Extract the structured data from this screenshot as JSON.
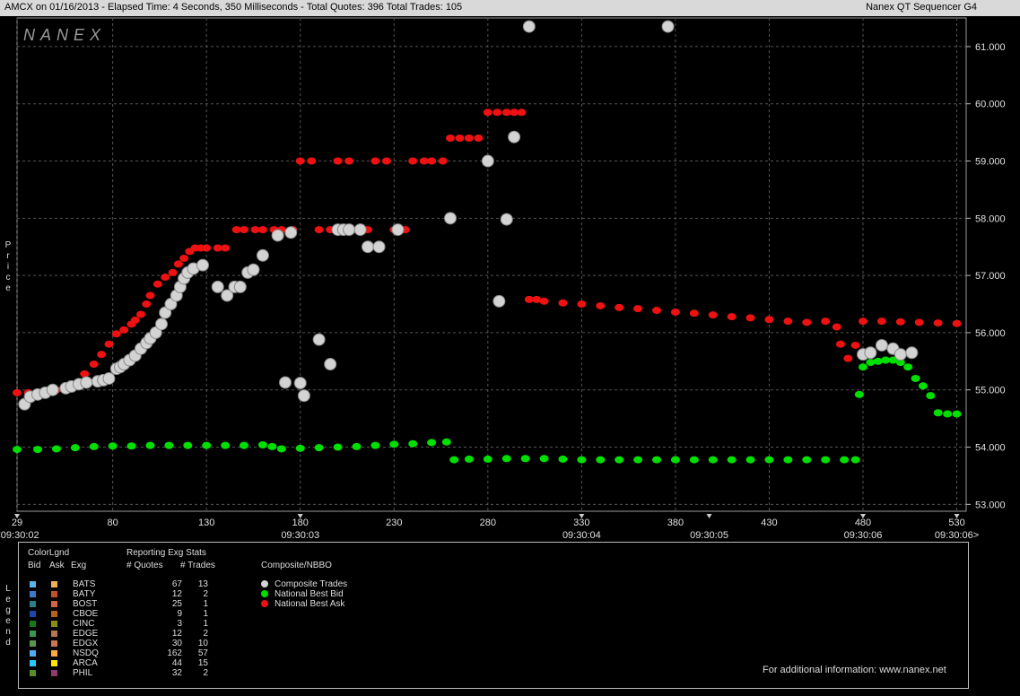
{
  "header": {
    "title": "AMCX on 01/16/2013  -  Elapsed Time: 4 Seconds, 350 Milliseconds  -  Total Quotes: 396  Total Trades: 105",
    "app_name": "Nanex QT Sequencer G4"
  },
  "watermark": "NANEX",
  "y_axis_label": [
    "P",
    "r",
    "i",
    "c",
    "e"
  ],
  "legend_axis_label": [
    "L",
    "e",
    "g",
    "e",
    "n",
    "d"
  ],
  "legend": {
    "colorlegend_title": "ColorLgnd",
    "bid_header": "Bid",
    "ask_header": "Ask",
    "exg_header": "Exg",
    "stats_title": "Reporting Exg Stats",
    "quotes_header": "# Quotes",
    "trades_header": "# Trades",
    "composite_title": "Composite/NBBO",
    "composite_items": [
      {
        "label": "Composite Trades",
        "color": "#d3d3d3"
      },
      {
        "label": "National Best Bid",
        "color": "#00e000"
      },
      {
        "label": "National Best Ask",
        "color": "#ee1111"
      }
    ],
    "exchanges": [
      {
        "name": "BATS",
        "quotes": "67",
        "trades": "13",
        "bid_color": "#5ab4e6",
        "ask_color": "#f0b050"
      },
      {
        "name": "BATY",
        "quotes": "12",
        "trades": "2",
        "bid_color": "#3c78c8",
        "ask_color": "#c05028"
      },
      {
        "name": "BOST",
        "quotes": "25",
        "trades": "1",
        "bid_color": "#2d7d8c",
        "ask_color": "#d26446"
      },
      {
        "name": "CBOE",
        "quotes": "9",
        "trades": "1",
        "bid_color": "#1e46aa",
        "ask_color": "#b46414"
      },
      {
        "name": "CINC",
        "quotes": "3",
        "trades": "1",
        "bid_color": "#167a16",
        "ask_color": "#8c8c14"
      },
      {
        "name": "EDGE",
        "quotes": "12",
        "trades": "2",
        "bid_color": "#3c9650",
        "ask_color": "#b47850"
      },
      {
        "name": "EDGX",
        "quotes": "30",
        "trades": "10",
        "bid_color": "#5a9650",
        "ask_color": "#c87850"
      },
      {
        "name": "NSDQ",
        "quotes": "162",
        "trades": "57",
        "bid_color": "#50aaf0",
        "ask_color": "#ffa83c"
      },
      {
        "name": "ARCA",
        "quotes": "44",
        "trades": "15",
        "bid_color": "#28c8ff",
        "ask_color": "#ffe600"
      },
      {
        "name": "PHIL",
        "quotes": "32",
        "trades": "2",
        "bid_color": "#5a8c28",
        "ask_color": "#8c3c6e"
      }
    ],
    "footer": "For additional information: www.nanex.net"
  },
  "chart_data": {
    "type": "scatter",
    "title": "AMCX on 01/16/2013",
    "ylabel": "Price",
    "ylim": [
      52.88,
      61.5
    ],
    "xlim": [
      29,
      535
    ],
    "y_ticks": [
      "53.000",
      "54.000",
      "55.000",
      "56.000",
      "57.000",
      "58.000",
      "59.000",
      "60.000",
      "61.000"
    ],
    "x_ticks": [
      {
        "value": 29,
        "label": "29"
      },
      {
        "value": 80,
        "label": "80"
      },
      {
        "value": 130,
        "label": "130"
      },
      {
        "value": 180,
        "label": "180"
      },
      {
        "value": 230,
        "label": "230"
      },
      {
        "value": 280,
        "label": "280"
      },
      {
        "value": 330,
        "label": "330"
      },
      {
        "value": 380,
        "label": "380"
      },
      {
        "value": 430,
        "label": "430"
      },
      {
        "value": 480,
        "label": "480"
      },
      {
        "value": 530,
        "label": "530"
      }
    ],
    "time_labels": [
      {
        "value": 29,
        "label": "<09:30:02"
      },
      {
        "value": 180,
        "label": "09:30:03"
      },
      {
        "value": 330,
        "label": "09:30:04"
      },
      {
        "value": 398,
        "label": "09:30:05"
      },
      {
        "value": 480,
        "label": "09:30:06"
      },
      {
        "value": 530,
        "label": "09:30:06>"
      }
    ],
    "grid": true,
    "series": [
      {
        "name": "National Best Bid",
        "color": "#00e000",
        "x": [
          29,
          40,
          50,
          60,
          70,
          80,
          90,
          100,
          110,
          120,
          130,
          140,
          150,
          160,
          165,
          170,
          180,
          190,
          200,
          210,
          220,
          230,
          240,
          250,
          258,
          262,
          270,
          280,
          290,
          300,
          310,
          320,
          330,
          340,
          350,
          360,
          370,
          380,
          390,
          400,
          410,
          420,
          430,
          440,
          450,
          460,
          470,
          476,
          478,
          480,
          484,
          488,
          492,
          496,
          500,
          504,
          508,
          512,
          516,
          520,
          525,
          530
        ],
        "y": [
          53.96,
          53.96,
          53.97,
          53.99,
          54.01,
          54.02,
          54.02,
          54.03,
          54.03,
          54.03,
          54.03,
          54.03,
          54.03,
          54.04,
          54.01,
          53.97,
          53.98,
          53.99,
          54.0,
          54.01,
          54.03,
          54.05,
          54.06,
          54.08,
          54.09,
          53.78,
          53.79,
          53.79,
          53.8,
          53.8,
          53.8,
          53.79,
          53.78,
          53.78,
          53.78,
          53.78,
          53.78,
          53.78,
          53.78,
          53.78,
          53.78,
          53.78,
          53.78,
          53.78,
          53.78,
          53.78,
          53.78,
          53.78,
          54.92,
          55.4,
          55.48,
          55.5,
          55.52,
          55.52,
          55.48,
          55.4,
          55.2,
          55.07,
          54.9,
          54.6,
          54.58,
          54.58
        ]
      },
      {
        "name": "National Best Ask",
        "color": "#ee1111",
        "x": [
          29,
          35,
          40,
          45,
          50,
          55,
          60,
          65,
          70,
          74,
          78,
          82,
          86,
          90,
          92,
          95,
          98,
          100,
          104,
          108,
          112,
          115,
          118,
          121,
          124,
          127,
          130,
          136,
          140,
          146,
          150,
          156,
          160,
          166,
          170,
          176,
          180,
          186,
          190,
          196,
          200,
          206,
          210,
          216,
          220,
          226,
          230,
          236,
          240,
          246,
          250,
          256,
          260,
          265,
          270,
          275,
          280,
          285,
          290,
          294,
          298,
          302,
          306,
          310,
          320,
          330,
          340,
          350,
          360,
          370,
          380,
          390,
          400,
          410,
          420,
          430,
          440,
          450,
          460,
          466,
          468,
          472,
          476,
          480,
          490,
          500,
          510,
          520,
          530
        ],
        "y": [
          54.95,
          54.95,
          54.96,
          54.98,
          55.0,
          55.05,
          55.1,
          55.28,
          55.45,
          55.62,
          55.8,
          55.98,
          56.05,
          56.15,
          56.22,
          56.32,
          56.5,
          56.65,
          56.85,
          56.97,
          57.05,
          57.2,
          57.3,
          57.42,
          57.48,
          57.48,
          57.48,
          57.48,
          57.48,
          57.8,
          57.8,
          57.8,
          57.8,
          57.8,
          57.8,
          57.8,
          59.0,
          59.0,
          57.8,
          57.8,
          59.0,
          59.0,
          57.8,
          57.8,
          59.0,
          59.0,
          57.8,
          57.8,
          59.0,
          59.0,
          59.0,
          59.0,
          59.4,
          59.4,
          59.4,
          59.4,
          59.85,
          59.85,
          59.85,
          59.85,
          59.85,
          56.58,
          56.58,
          56.55,
          56.52,
          56.5,
          56.47,
          56.44,
          56.42,
          56.39,
          56.36,
          56.34,
          56.31,
          56.28,
          56.26,
          56.23,
          56.2,
          56.18,
          56.2,
          56.1,
          55.8,
          55.55,
          55.78,
          56.2,
          56.2,
          56.19,
          56.18,
          56.17,
          56.16
        ]
      },
      {
        "name": "Composite Trades",
        "color": "#d3d3d3",
        "x": [
          33,
          36,
          40,
          44,
          48,
          55,
          58,
          62,
          66,
          72,
          75,
          78,
          82,
          84,
          86,
          89,
          92,
          95,
          98,
          100,
          103,
          106,
          108,
          111,
          114,
          116,
          118,
          120,
          123,
          128,
          136,
          141,
          145,
          148,
          152,
          155,
          160,
          168,
          172,
          175,
          180,
          182,
          190,
          196,
          200,
          203,
          206,
          212,
          216,
          222,
          232,
          260,
          280,
          286,
          290,
          294,
          302,
          376,
          480,
          484,
          490,
          496,
          500,
          506
        ],
        "y": [
          54.75,
          54.88,
          54.92,
          54.95,
          55.0,
          55.03,
          55.06,
          55.1,
          55.13,
          55.15,
          55.17,
          55.2,
          55.37,
          55.4,
          55.45,
          55.52,
          55.6,
          55.72,
          55.82,
          55.9,
          56.0,
          56.15,
          56.35,
          56.5,
          56.65,
          56.8,
          56.95,
          57.05,
          57.12,
          57.18,
          56.8,
          56.65,
          56.8,
          56.8,
          57.05,
          57.1,
          57.35,
          57.7,
          55.13,
          57.75,
          55.12,
          54.9,
          55.88,
          55.45,
          57.8,
          57.8,
          57.8,
          57.8,
          57.5,
          57.5,
          57.8,
          58.0,
          59.0,
          56.55,
          57.98,
          59.42,
          61.35,
          61.35,
          55.62,
          55.65,
          55.78,
          55.72,
          55.62,
          55.65
        ]
      }
    ]
  }
}
